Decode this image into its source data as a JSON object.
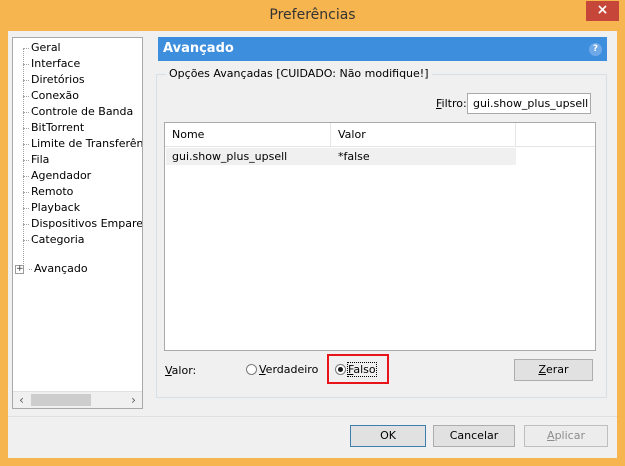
{
  "window": {
    "title": "Preferências",
    "close_glyph": "×"
  },
  "tree": {
    "items": [
      "Geral",
      "Interface",
      "Diretórios",
      "Conexão",
      "Controle de Banda",
      "BitTorrent",
      "Limite de Transferên",
      "Fila",
      "Agendador",
      "Remoto",
      "Playback",
      "Dispositivos Empare",
      "Categoria",
      "Avançado"
    ],
    "expander_glyph": "+",
    "scroll_left": "‹",
    "scroll_right": "›"
  },
  "panel": {
    "title": "Avançado",
    "help_glyph": "?",
    "header_color": "#3e8ede",
    "group_label": "Opções Avançadas [CUIDADO: Não modifique!]",
    "filter_label_prefix": "F",
    "filter_label_rest": "iltro:",
    "filter_value": "gui.show_plus_upsell",
    "columns": [
      "Nome",
      "Valor"
    ],
    "rows": [
      {
        "name": "gui.show_plus_upsell",
        "value": "*false"
      }
    ],
    "value_label_u": "V",
    "value_label_rest": "alor:",
    "radio_true_u": "V",
    "radio_true_rest": "erdadeiro",
    "radio_false_u": "F",
    "radio_false_rest": "also",
    "reset_u": "Z",
    "reset_rest": "erar",
    "highlight_color": "#e8141a"
  },
  "buttons": {
    "ok": "OK",
    "cancel": "Cancelar",
    "apply_u": "A",
    "apply_rest": "plicar"
  }
}
